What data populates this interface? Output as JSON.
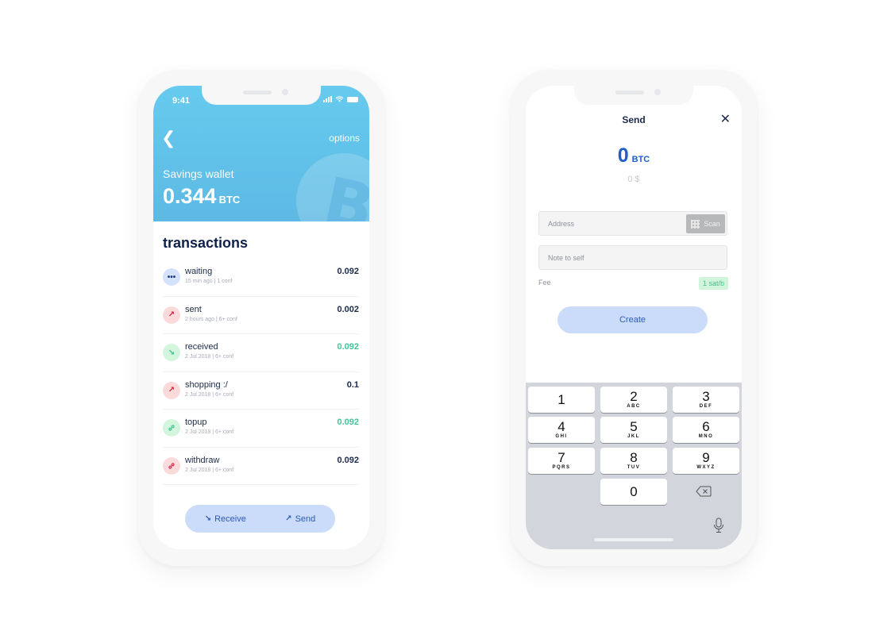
{
  "wallet_screen": {
    "status": {
      "time": "9:41"
    },
    "header": {
      "back_icon": "chevron-left-icon",
      "options_label": "options",
      "wallet_name": "Savings wallet",
      "balance": "0.344",
      "balance_unit": "BTC",
      "background_icon": "bitcoin-icon"
    },
    "transactions_title": "transactions",
    "transactions": [
      {
        "name": "waiting",
        "meta": "15 min ago | 1 conf",
        "amount": "0.092",
        "icon": "dots-icon",
        "icon_color": "blue",
        "amount_color": "default"
      },
      {
        "name": "sent",
        "meta": "2 hours ago | 6+ conf",
        "amount": "0.002",
        "icon": "arrow-up-right-icon",
        "icon_color": "red",
        "amount_color": "default"
      },
      {
        "name": "received",
        "meta": "2 Jul 2018 | 6+ conf",
        "amount": "0.092",
        "icon": "arrow-down-right-icon",
        "icon_color": "green",
        "amount_color": "green"
      },
      {
        "name": "shopping :/",
        "meta": "2 Jul 2018 | 6+ conf",
        "amount": "0.1",
        "icon": "arrow-up-right-icon",
        "icon_color": "red",
        "amount_color": "default"
      },
      {
        "name": "topup",
        "meta": "2 Jul 2018 | 6+ conf",
        "amount": "0.092",
        "icon": "link-icon",
        "icon_color": "green",
        "amount_color": "green"
      },
      {
        "name": "withdraw",
        "meta": "2 Jul 2018 | 6+ conf",
        "amount": "0.092",
        "icon": "link-icon",
        "icon_color": "red",
        "amount_color": "default"
      }
    ],
    "actions": {
      "receive_label": "Receive",
      "send_label": "Send"
    }
  },
  "send_screen": {
    "title": "Send",
    "close_icon": "close-icon",
    "amount": "0",
    "amount_unit": "BTC",
    "fiat_amount": "0 $",
    "address_placeholder": "Address",
    "scan_label": "Scan",
    "note_placeholder": "Note to self",
    "fee_label": "Fee",
    "fee_value": "1 sat/b",
    "create_label": "Create",
    "keypad": [
      {
        "num": "1",
        "letters": ""
      },
      {
        "num": "2",
        "letters": "ABC"
      },
      {
        "num": "3",
        "letters": "DEF"
      },
      {
        "num": "4",
        "letters": "GHI"
      },
      {
        "num": "5",
        "letters": "JKL"
      },
      {
        "num": "6",
        "letters": "MNO"
      },
      {
        "num": "7",
        "letters": "PQRS"
      },
      {
        "num": "8",
        "letters": "TUV"
      },
      {
        "num": "9",
        "letters": "WXYZ"
      },
      {
        "num": "0",
        "letters": ""
      }
    ]
  },
  "colors": {
    "header_blue": "#66cbee",
    "accent_blue": "#1e5fc8",
    "pill_blue": "#cadcfa",
    "positive_green": "#44c49b",
    "negative_red": "#d81b3f"
  }
}
